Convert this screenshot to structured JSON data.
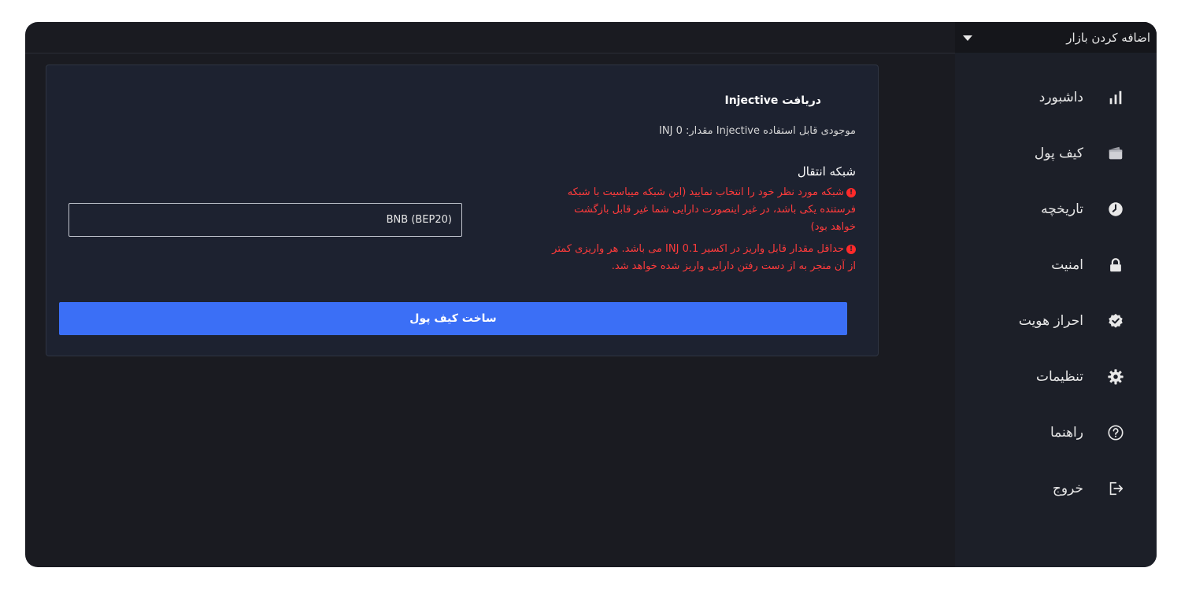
{
  "market": {
    "label": "اضافه کردن بازار"
  },
  "sidebar": {
    "items": [
      {
        "label": "داشبورد",
        "icon": "bar-chart-icon"
      },
      {
        "label": "کیف پول",
        "icon": "wallet-icon"
      },
      {
        "label": "تاریخچه",
        "icon": "clock-icon"
      },
      {
        "label": "امنیت",
        "icon": "lock-icon"
      },
      {
        "label": "احراز هویت",
        "icon": "verified-icon"
      },
      {
        "label": "تنظیمات",
        "icon": "gear-icon"
      },
      {
        "label": "راهنما",
        "icon": "help-icon"
      },
      {
        "label": "خروج",
        "icon": "logout-icon"
      }
    ]
  },
  "receive": {
    "title": "دریافت Injective",
    "balance": "موجودی قابل استفاده Injective مقدار: 0 INJ",
    "network_title": "شبکه انتقال",
    "warning1": "شبکه مورد نظر خود را انتخاب نمایید (این شبکه میباسیت با شبکه فرستنده یکی باشد، در غیر اینصورت دارایی شما غیر قابل بازگشت خواهد بود)",
    "warning2": "حداقل مقدار قابل واریز در اکسیر 0.1 INJ می باشد. هر واریزی کمتر از آن منجر به از دست رفتن دارایی واریز شده خواهد شد.",
    "network_value": "BNB (BEP20)",
    "create_button": "ساخت کیف پول"
  },
  "colors": {
    "accent": "#3b6ff6",
    "warning": "#ff3b3b",
    "background": "#1a1b21",
    "card": "#1d2230"
  }
}
